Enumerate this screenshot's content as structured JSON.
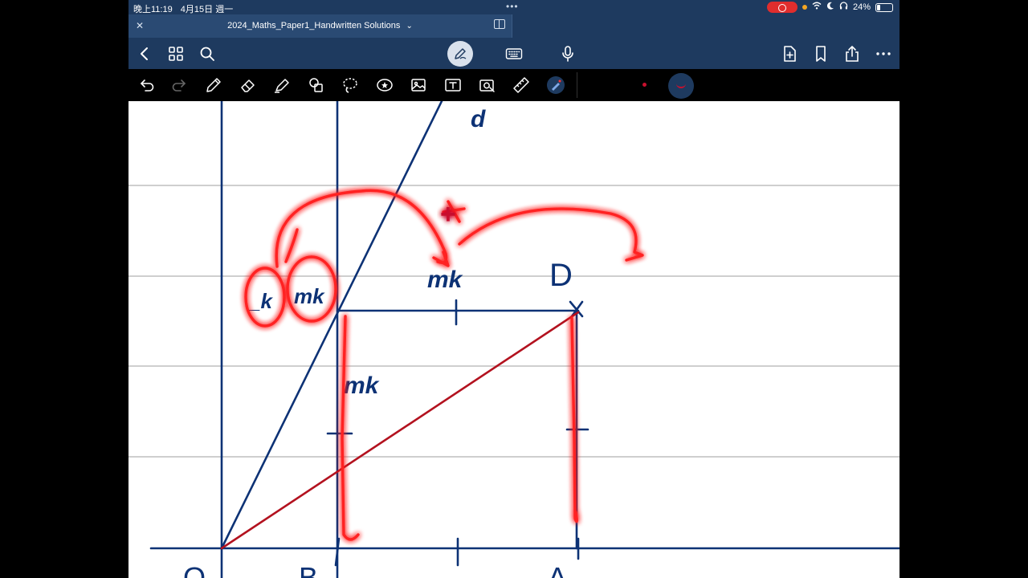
{
  "status_bar": {
    "time": "晚上11:19",
    "date": "4月15日 週一",
    "dots": "•••",
    "battery_percent": "24%",
    "battery_level": 0.24,
    "recording": true
  },
  "document": {
    "title": "2024_Maths_Paper1_Handwritten Solutions",
    "title_chevron": "⌄"
  },
  "nav_bar": {
    "icons": [
      "back-icon",
      "grid-icon",
      "search-icon",
      "pen-mode-icon",
      "keyboard-icon",
      "microphone-icon",
      "add-page-icon",
      "bookmark-icon",
      "share-icon",
      "more-icon"
    ]
  },
  "toolbar": {
    "tools": [
      "undo-icon",
      "redo-icon",
      "pen-icon",
      "eraser-icon",
      "highlighter-icon",
      "shapes-icon",
      "lasso-icon",
      "elements-icon",
      "image-icon",
      "text-icon",
      "camera-icon",
      "ruler-icon",
      "laser-pointer-icon"
    ],
    "active_color": "#c8102e"
  },
  "handwriting": {
    "letter_d": "d",
    "mk_left": "mk",
    "k_left": "_k",
    "plus": "+",
    "mk_top": "mk",
    "D": "D",
    "mk_mid": "mk",
    "B": "B",
    "O": "O",
    "A": "A"
  },
  "colors": {
    "nav_bg": "#1e3a5f",
    "ink_blue": "#0d3275",
    "ink_red": "#c8102e",
    "glow_red": "#ff1a1a"
  }
}
